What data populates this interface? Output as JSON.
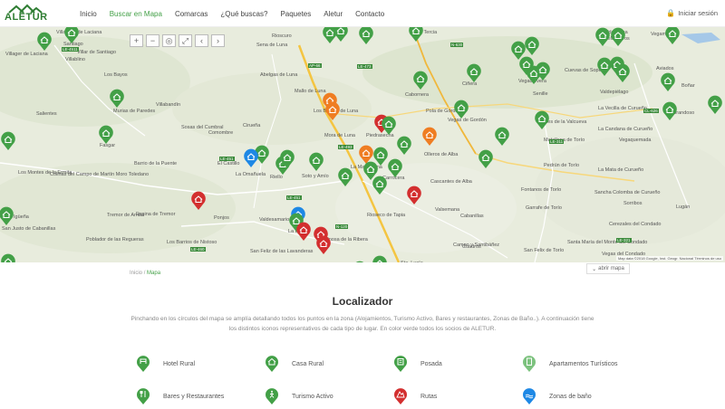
{
  "header": {
    "logo_text": "ALETUR",
    "nav": [
      "Inicio",
      "Buscar en Mapa",
      "Comarcas",
      "¿Qué buscas?",
      "Paquetes",
      "Aletur",
      "Contacto"
    ],
    "active_index": 1,
    "login_label": "Iniciar sesión"
  },
  "map": {
    "controls": [
      "+",
      "−",
      "◎",
      "⤢",
      "‹",
      "›"
    ],
    "places": [
      {
        "name": "Villaseca de Laciana",
        "cls": "p1"
      },
      {
        "name": "Villager de Laciana",
        "cls": "p2"
      },
      {
        "name": "Villablino",
        "cls": "p3"
      },
      {
        "name": "Rioscuro",
        "cls": "p4"
      },
      {
        "name": "Sena de Luna",
        "cls": "p5"
      },
      {
        "name": "Abelgas de Luna",
        "cls": "p6"
      },
      {
        "name": "Los Barrios de Luna",
        "cls": "p7"
      },
      {
        "name": "Mallo de Luna",
        "cls": "p8"
      },
      {
        "name": "Mora de Luna",
        "cls": "p9"
      },
      {
        "name": "La Tercia",
        "cls": "p10"
      },
      {
        "name": "Pola de Gordón",
        "cls": "p11"
      },
      {
        "name": "Cabornera",
        "cls": "p12"
      },
      {
        "name": "Ciñera",
        "cls": "p13"
      },
      {
        "name": "Vegacervera",
        "cls": "p14"
      },
      {
        "name": "Valdelugueros",
        "cls": "p15"
      },
      {
        "name": "Vegamián",
        "cls": "p16"
      },
      {
        "name": "Boñar",
        "cls": "p17"
      },
      {
        "name": "Sosas del Cumbral",
        "cls": "p18"
      },
      {
        "name": "Comombre",
        "cls": "p19"
      },
      {
        "name": "Cirueña",
        "cls": "p20"
      },
      {
        "name": "Piedrasecha",
        "cls": "p21"
      },
      {
        "name": "Olleros de Alba",
        "cls": "p22"
      },
      {
        "name": "La Magdalena",
        "cls": "p23"
      },
      {
        "name": "Soto y Amío",
        "cls": "p24"
      },
      {
        "name": "La Omañuela",
        "cls": "p25"
      },
      {
        "name": "Riello",
        "cls": "p26"
      },
      {
        "name": "El Castillo",
        "cls": "p27"
      },
      {
        "name": "Barrio de la Puente",
        "cls": "p28"
      },
      {
        "name": "Fasgar",
        "cls": "p29"
      },
      {
        "name": "Murias de Paredes",
        "cls": "p30"
      },
      {
        "name": "Villabandín",
        "cls": "p31"
      },
      {
        "name": "Salientes",
        "cls": "p32"
      },
      {
        "name": "Los Bayos",
        "cls": "p33"
      },
      {
        "name": "Colinas del Campo de Martín Moro Toledano",
        "cls": "p34"
      },
      {
        "name": "Los Montes de la Ermita",
        "cls": "p35"
      },
      {
        "name": "Igüeña",
        "cls": "p36"
      },
      {
        "name": "Tremor de Arriba",
        "cls": "p37"
      },
      {
        "name": "Espina de Tremor",
        "cls": "p38"
      },
      {
        "name": "Ponjos",
        "cls": "p39"
      },
      {
        "name": "Valdesamario",
        "cls": "p40"
      },
      {
        "name": "La Utrera",
        "cls": "p41"
      },
      {
        "name": "Rioseco de Tapia",
        "cls": "p42"
      },
      {
        "name": "Espinosa de la Ribera",
        "cls": "p43"
      },
      {
        "name": "Carrocera",
        "cls": "p44"
      },
      {
        "name": "Cascantes de Alba",
        "cls": "p45"
      },
      {
        "name": "Valsemana",
        "cls": "p46"
      },
      {
        "name": "Cabanillas",
        "cls": "p47"
      },
      {
        "name": "Cuadros",
        "cls": "p48"
      },
      {
        "name": "Campo y Santibáñez",
        "cls": "p49"
      },
      {
        "name": "Garrafe de Torío",
        "cls": "p50"
      },
      {
        "name": "Fontanos de Torío",
        "cls": "p51"
      },
      {
        "name": "Pedrún de Torío",
        "cls": "p52"
      },
      {
        "name": "Matallana de Torío",
        "cls": "p53"
      },
      {
        "name": "La Vecilla de Curueño",
        "cls": "p54"
      },
      {
        "name": "La Candana de Curueño",
        "cls": "p55"
      },
      {
        "name": "Vegaquemada",
        "cls": "p56"
      },
      {
        "name": "La Mata de Curueño",
        "cls": "p57"
      },
      {
        "name": "Sancha Colomba de Curueño",
        "cls": "p58"
      },
      {
        "name": "Santa María del Monte del Condado",
        "cls": "p59"
      },
      {
        "name": "Vegas del Condado",
        "cls": "p60"
      },
      {
        "name": "Cerezales del Condado",
        "cls": "p61"
      },
      {
        "name": "Lugán",
        "cls": "p62"
      },
      {
        "name": "Sorriba",
        "cls": "p63"
      },
      {
        "name": "San Felix de Torío",
        "cls": "p64"
      },
      {
        "name": "San Feliz de las Lavanderas",
        "cls": "p65"
      },
      {
        "name": "Los Barrios de Nistoso",
        "cls": "p66"
      },
      {
        "name": "Poblador de las Regueras",
        "cls": "p67"
      },
      {
        "name": "San Justo de Cabanillas",
        "cls": "p68"
      },
      {
        "name": "Santiago",
        "cls": "p69"
      },
      {
        "name": "Villar de Santiago",
        "cls": "p70"
      },
      {
        "name": "Vegas de Gordón",
        "cls": "p71"
      },
      {
        "name": "Robles de la Valcueva",
        "cls": "p72"
      },
      {
        "name": "Cuevas de Sopeña",
        "cls": "p73"
      },
      {
        "name": "Valdepiélago",
        "cls": "p74"
      },
      {
        "name": "Grandoso",
        "cls": "p75"
      },
      {
        "name": "Valdehuesa",
        "cls": "p76"
      },
      {
        "name": "Aviados",
        "cls": "p77"
      },
      {
        "name": "Sorribos",
        "cls": "p78"
      },
      {
        "name": "Sta. Lucía",
        "cls": "p79"
      },
      {
        "name": "Senille",
        "cls": "p80"
      }
    ],
    "roads": [
      "LE-4511",
      "AP-66",
      "LE-473",
      "N-630",
      "CL-626",
      "LE-493",
      "LE-451",
      "LE-460",
      "N-120",
      "LE-311",
      "LE-321",
      "LE-451"
    ],
    "attribution": "Map data ©2018 Google, Inst. Geogr. Nacional   Términos de uso"
  },
  "breadcrumb": {
    "home": "Inicio",
    "separator": "/",
    "current": "Mapa"
  },
  "open_map_label": "abrir mapa",
  "localizador": {
    "title": "Localizador",
    "description": "Pinchando en los círculos del mapa se amplía detallando todos los puntos en la zona (Alojamientos, Turismo Activo, Bares y restaurantes, Zonas de Baño..). A continuación tiene los distintos iconos representativos de cada tipo de lugar. En color verde todos los socios de ALETUR.",
    "legend": [
      {
        "label": "Hotel Rural",
        "color": "#43a047"
      },
      {
        "label": "Casa Rural",
        "color": "#43a047"
      },
      {
        "label": "Posada",
        "color": "#43a047"
      },
      {
        "label": "Apartamentos Turísticos",
        "color": "#7cc27e"
      },
      {
        "label": "Bares y Restaurantes",
        "color": "#43a047"
      },
      {
        "label": "Turismo Activo",
        "color": "#43a047"
      },
      {
        "label": "Rutas",
        "color": "#d32f2f"
      },
      {
        "label": "Zonas de baño",
        "color": "#1e88e5"
      }
    ]
  }
}
